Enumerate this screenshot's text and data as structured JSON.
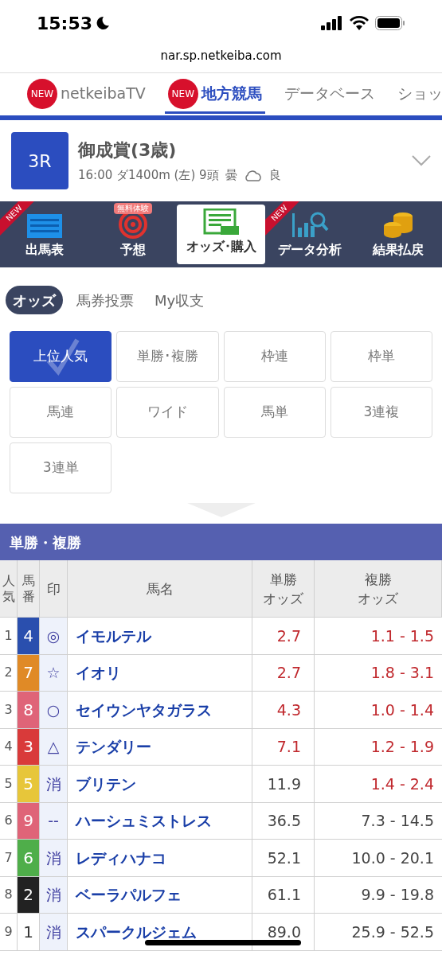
{
  "status_bar": {
    "time": "15:53"
  },
  "url": "nar.sp.netkeiba.com",
  "nav_tabs": [
    {
      "label": "netkeibaTV",
      "badge": "NEW",
      "selected": false
    },
    {
      "label": "地方競馬",
      "badge": "NEW",
      "selected": true
    },
    {
      "label": "データベース",
      "selected": false
    },
    {
      "label": "ショッ",
      "selected": false
    }
  ],
  "race": {
    "number": "3R",
    "name": "御成賞(3歳)",
    "info": "16:00 ダ1400m (左) 9頭",
    "weather": "曇",
    "going": "良"
  },
  "menu": [
    {
      "label": "出馬表",
      "kind": "list",
      "ribbon": "NEW",
      "selected": false
    },
    {
      "label": "予想",
      "kind": "target",
      "badge": "無料体験",
      "selected": false
    },
    {
      "label": "オッズ･購入",
      "kind": "bet",
      "selected": true
    },
    {
      "label": "データ分析",
      "kind": "chart",
      "ribbon": "NEW",
      "selected": false
    },
    {
      "label": "結果払戻",
      "kind": "coins",
      "selected": false
    }
  ],
  "sub_tabs": [
    {
      "label": "オッズ",
      "selected": true
    },
    {
      "label": "馬券投票",
      "selected": false
    },
    {
      "label": "My収支",
      "selected": false
    }
  ],
  "bet_types": [
    {
      "label": "上位人気",
      "selected": true
    },
    {
      "label": "単勝･複勝",
      "selected": false
    },
    {
      "label": "枠連",
      "selected": false
    },
    {
      "label": "枠単",
      "selected": false
    },
    {
      "label": "馬連",
      "selected": false
    },
    {
      "label": "ワイド",
      "selected": false
    },
    {
      "label": "馬単",
      "selected": false
    },
    {
      "label": "3連複",
      "selected": false
    },
    {
      "label": "3連単",
      "selected": false
    }
  ],
  "section_title": "単勝・複勝",
  "table": {
    "columns": [
      {
        "lines": [
          "人気"
        ]
      },
      {
        "lines": [
          "馬番"
        ]
      },
      {
        "lines": [
          "印"
        ]
      },
      {
        "lines": [
          "馬名"
        ]
      },
      {
        "lines": [
          "単勝",
          "オッズ"
        ]
      },
      {
        "lines": [
          "複勝",
          "オッズ"
        ]
      }
    ],
    "rows": [
      {
        "rank": "1",
        "number": "4",
        "color": "#2a4fae",
        "mark": "◎",
        "name": "イモルテル",
        "win": "2.7",
        "win_hot": true,
        "place": "1.1 - 1.5",
        "place_hot": true
      },
      {
        "rank": "2",
        "number": "7",
        "color": "#e08a26",
        "mark": "☆",
        "name": "イオリ",
        "win": "2.7",
        "win_hot": true,
        "place": "1.8 - 3.1",
        "place_hot": true
      },
      {
        "rank": "3",
        "number": "8",
        "color": "#df6478",
        "mark": "○",
        "name": "セイウンヤタガラス",
        "win": "4.3",
        "win_hot": true,
        "place": "1.0 - 1.4",
        "place_hot": true
      },
      {
        "rank": "4",
        "number": "3",
        "color": "#d93a3a",
        "mark": "△",
        "name": "テンダリー",
        "win": "7.1",
        "win_hot": true,
        "place": "1.2 - 1.9",
        "place_hot": true
      },
      {
        "rank": "5",
        "number": "5",
        "color": "#e7c63a",
        "mark": "消",
        "name": "ブリテン",
        "win": "11.9",
        "win_hot": false,
        "place": "1.4 - 2.4",
        "place_hot": true
      },
      {
        "rank": "6",
        "number": "9",
        "color": "#df6478",
        "mark": "--",
        "name": "ハーシュミストレス",
        "win": "36.5",
        "win_hot": false,
        "place": "7.3 - 14.5",
        "place_hot": false
      },
      {
        "rank": "7",
        "number": "6",
        "color": "#4fae4a",
        "mark": "消",
        "name": "レディハナコ",
        "win": "52.1",
        "win_hot": false,
        "place": "10.0 - 20.1",
        "place_hot": false
      },
      {
        "rank": "8",
        "number": "2",
        "color": "#222222",
        "mark": "消",
        "name": "ベーラパルフェ",
        "win": "61.1",
        "win_hot": false,
        "place": "9.9 - 19.8",
        "place_hot": false
      },
      {
        "rank": "9",
        "number": "1",
        "color": "#ffffff",
        "mark": "消",
        "name": "スパークルジェム",
        "win": "89.0",
        "win_hot": false,
        "place": "25.9 - 52.5",
        "place_hot": false
      }
    ]
  }
}
